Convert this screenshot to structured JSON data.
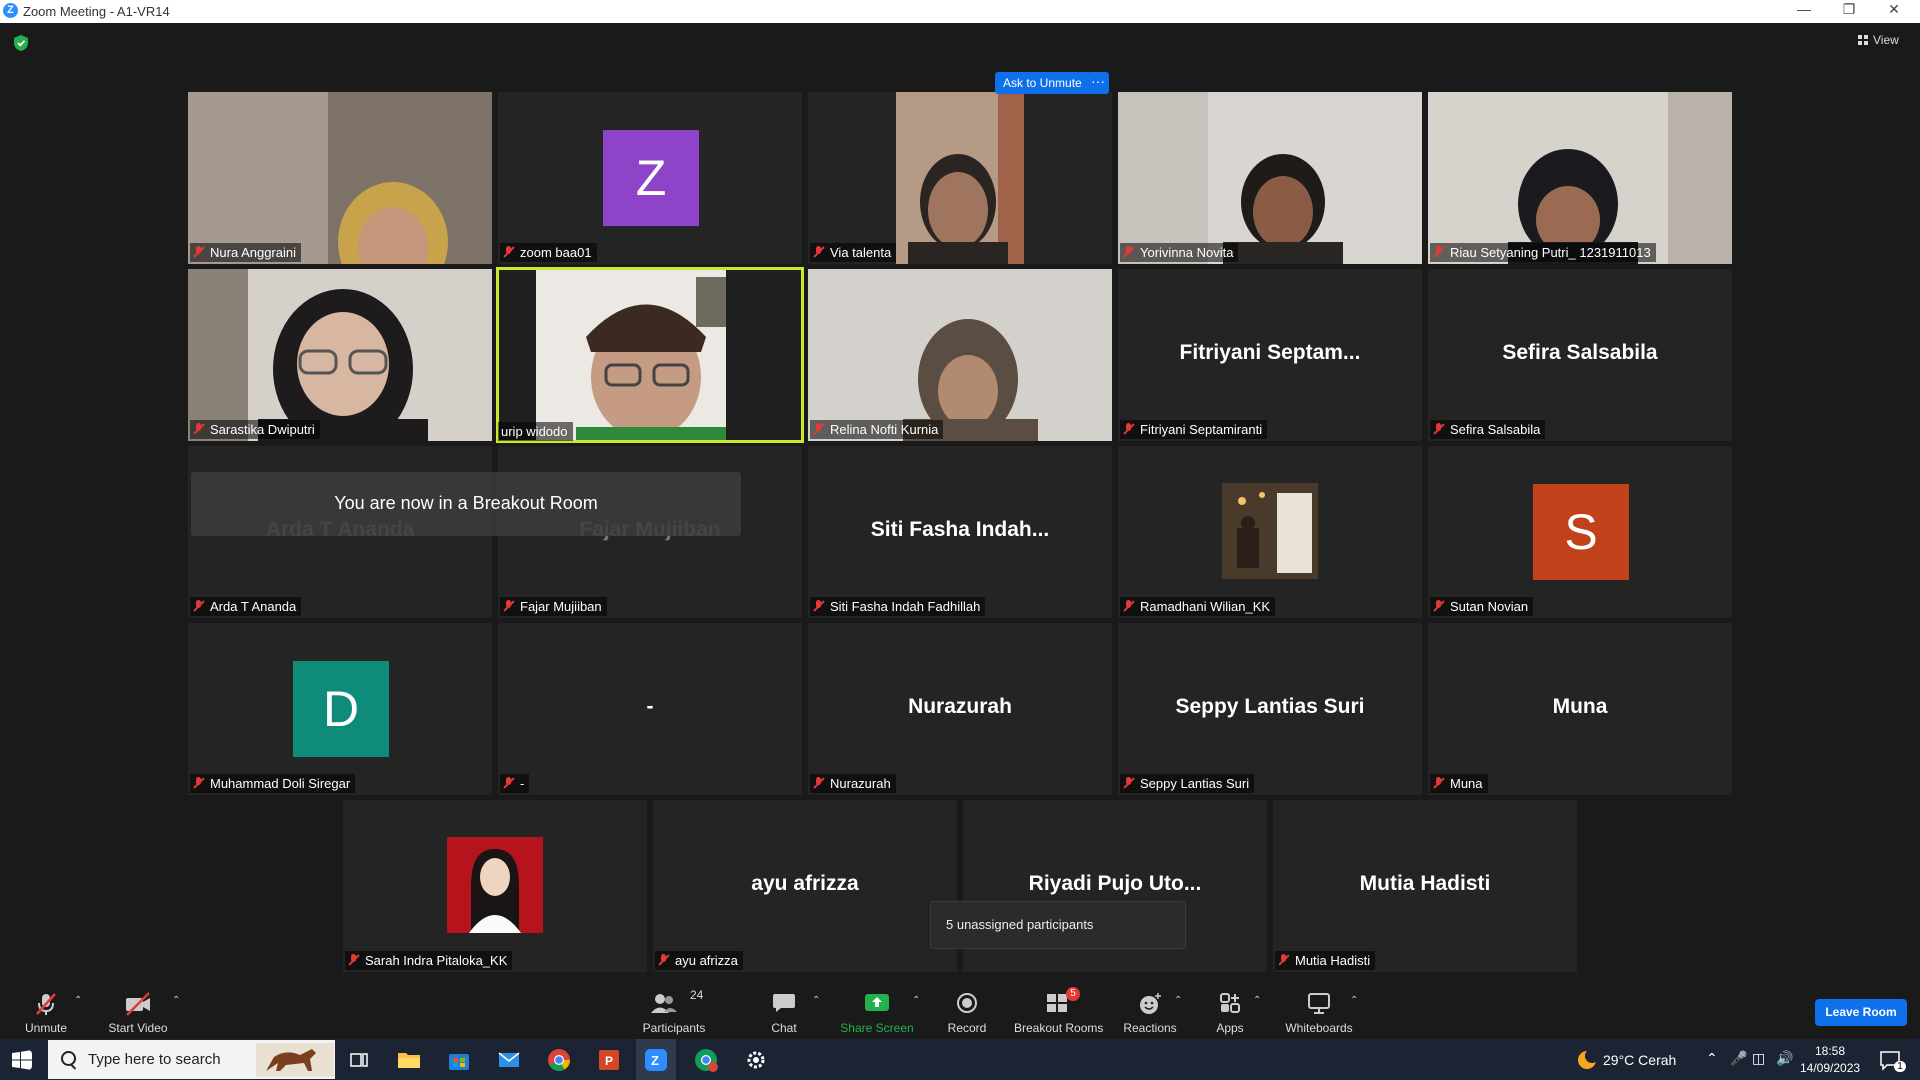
{
  "window": {
    "title": "Zoom Meeting - A1-VR14",
    "app_icon": "Z"
  },
  "view_button": {
    "label": "View"
  },
  "ask_to_unmute": {
    "label": "Ask to Unmute",
    "more": "···"
  },
  "toast": {
    "text": "You are now in a Breakout Room"
  },
  "unassigned": {
    "text": "5 unassigned participants"
  },
  "tiles": [
    {
      "name": "Nura Anggraini",
      "display": ""
    },
    {
      "name": "zoom baa01",
      "display": "",
      "avatar_letter": "Z",
      "avatar_color": "#8e44c8"
    },
    {
      "name": "Via talenta",
      "display": ""
    },
    {
      "name": "Yorivinna Novita",
      "display": ""
    },
    {
      "name": "Riau Setyaning Putri_ 1231911013",
      "display": ""
    },
    {
      "name": "Sarastika Dwiputri",
      "display": ""
    },
    {
      "name": "urip widodo",
      "display": ""
    },
    {
      "name": "Relina Nofti Kurnia",
      "display": ""
    },
    {
      "name": "Fitriyani Septamiranti",
      "display": "Fitriyani  Septam..."
    },
    {
      "name": "Sefira Salsabila",
      "display": "Sefira Salsabila"
    },
    {
      "name": "Arda T Ananda",
      "display": "Arda T Ananda"
    },
    {
      "name": "Fajar Mujiiban",
      "display": "Fajar Mujiiban"
    },
    {
      "name": "Siti Fasha Indah Fadhillah",
      "display": "Siti Fasha Indah..."
    },
    {
      "name": "Ramadhani Wilian_KK",
      "display": ""
    },
    {
      "name": "Sutan Novian",
      "display": "",
      "avatar_letter": "S",
      "avatar_color": "#c1421a"
    },
    {
      "name": "Muhammad Doli Siregar",
      "display": "",
      "avatar_letter": "D",
      "avatar_color": "#0f8b7a"
    },
    {
      "name": "-",
      "display": "-"
    },
    {
      "name": "Nurazurah",
      "display": "Nurazurah"
    },
    {
      "name": "Seppy Lantias Suri",
      "display": "Seppy Lantias Suri"
    },
    {
      "name": "Muna",
      "display": "Muna"
    },
    {
      "name": "Sarah Indra Pitaloka_KK",
      "display": ""
    },
    {
      "name": "ayu afrizza",
      "display": "ayu afrizza"
    },
    {
      "name": "Riyadi Pujo Utomo",
      "display": "Riyadi Pujo Uto..."
    },
    {
      "name": "Mutia Hadisti",
      "display": "Mutia Hadisti"
    }
  ],
  "toolbar": {
    "unmute": "Unmute",
    "start_video": "Start Video",
    "participants": "Participants",
    "participants_count": "24",
    "chat": "Chat",
    "share_screen": "Share Screen",
    "record": "Record",
    "breakout_rooms": "Breakout Rooms",
    "breakout_badge": "5",
    "reactions": "Reactions",
    "apps": "Apps",
    "whiteboards": "Whiteboards",
    "leave": "Leave Room",
    "accent": "#0e71eb",
    "share_color": "#23b14d"
  },
  "taskbar": {
    "search_placeholder": "Type here to search",
    "weather": "29°C  Cerah",
    "time": "18:58",
    "date": "14/09/2023",
    "notif_count": "1"
  }
}
